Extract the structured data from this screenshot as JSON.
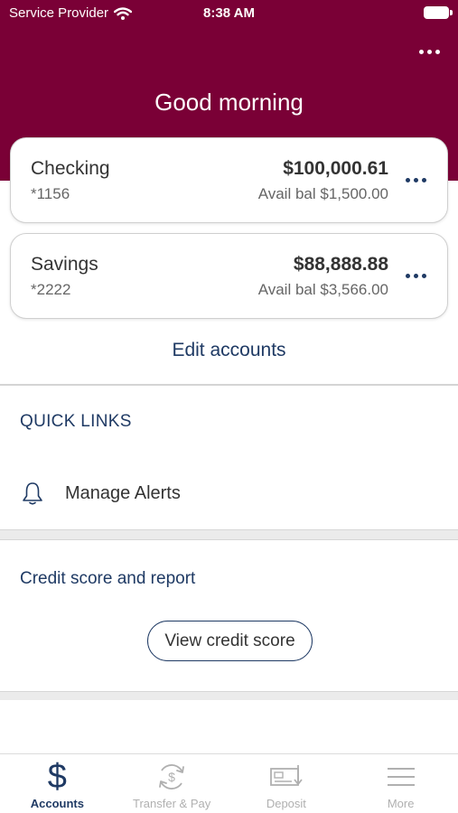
{
  "status_bar": {
    "carrier": "Service Provider",
    "time": "8:38 AM"
  },
  "header": {
    "greeting": "Good morning"
  },
  "accounts": [
    {
      "name": "Checking",
      "number": "*1156",
      "balance": "$100,000.61",
      "available": "Avail bal $1,500.00"
    },
    {
      "name": "Savings",
      "number": "*2222",
      "balance": "$88,888.88",
      "available": "Avail bal $3,566.00"
    }
  ],
  "edit_accounts_label": "Edit accounts",
  "quick_links": {
    "title": "QUICK LINKS",
    "items": [
      {
        "label": "Manage Alerts",
        "icon": "bell-icon"
      }
    ]
  },
  "credit": {
    "title": "Credit score and report",
    "button_label": "View credit score"
  },
  "tabbar": {
    "tabs": [
      {
        "label": "Accounts",
        "icon": "dollar-icon",
        "active": true
      },
      {
        "label": "Transfer & Pay",
        "icon": "transfer-icon",
        "active": false
      },
      {
        "label": "Deposit",
        "icon": "check-deposit-icon",
        "active": false
      },
      {
        "label": "More",
        "icon": "menu-icon",
        "active": false
      }
    ]
  },
  "colors": {
    "brand": "#7a0036",
    "accent": "#1f3a64",
    "inactive": "#b0b0b0"
  }
}
